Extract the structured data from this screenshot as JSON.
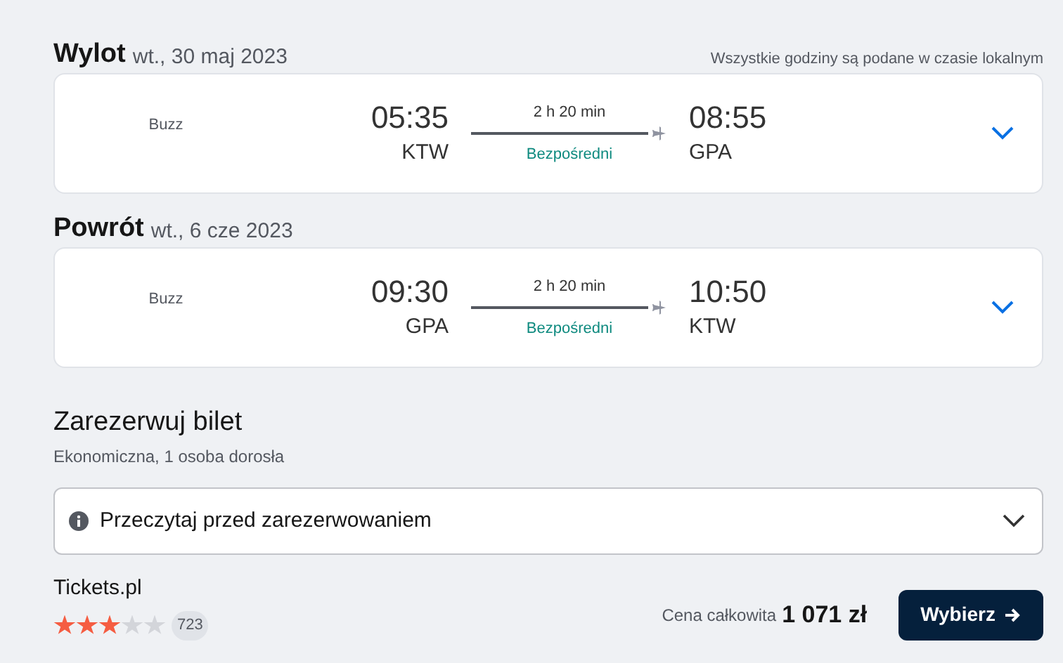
{
  "legs": [
    {
      "label": "Wylot",
      "date": "wt., 30 maj 2023",
      "note": "Wszystkie godziny są podane w czasie lokalnym",
      "airline": "Buzz",
      "dep_time": "05:35",
      "dep_airport": "KTW",
      "duration": "2 h 20 min",
      "stops": "Bezpośredni",
      "arr_time": "08:55",
      "arr_airport": "GPA",
      "expanded": false
    },
    {
      "label": "Powrót",
      "date": "wt., 6 cze 2023",
      "airline": "Buzz",
      "dep_time": "09:30",
      "dep_airport": "GPA",
      "duration": "2 h 20 min",
      "stops": "Bezpośredni",
      "arr_time": "10:50",
      "arr_airport": "KTW",
      "expanded": false
    }
  ],
  "booking": {
    "title": "Zarezerwuj bilet",
    "subtitle": "Ekonomiczna, 1 osoba dorosła",
    "notice": "Przeczytaj przed zarezerwowaniem",
    "notice_expanded": false,
    "provider": "Tickets.pl",
    "stars": 3,
    "reviews": "723",
    "price_label": "Cena całkowita",
    "price": "1 071 zł",
    "button": "Wybierz"
  }
}
